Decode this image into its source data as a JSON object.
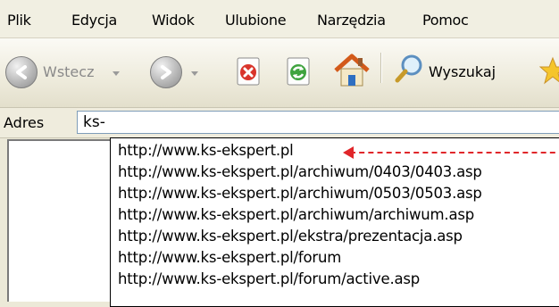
{
  "menu": {
    "items": [
      "Plik",
      "Edycja",
      "Widok",
      "Ulubione",
      "Narzędzia",
      "Pomoc"
    ]
  },
  "toolbar": {
    "back_label": "Wstecz",
    "search_label": "Wyszukaj"
  },
  "address": {
    "label": "Adres",
    "value": "ks-"
  },
  "autocomplete": {
    "items": [
      "http://www.ks-ekspert.pl",
      "http://www.ks-ekspert.pl/archiwum/0403/0403.asp",
      "http://www.ks-ekspert.pl/archiwum/0503/0503.asp",
      "http://www.ks-ekspert.pl/archiwum/archiwum.asp",
      "http://www.ks-ekspert.pl/ekstra/prezentacja.asp",
      "http://www.ks-ekspert.pl/forum",
      "http://www.ks-ekspert.pl/forum/active.asp"
    ]
  },
  "colors": {
    "annotation_arrow": "#e0262a",
    "chrome": "#ece9d8"
  }
}
